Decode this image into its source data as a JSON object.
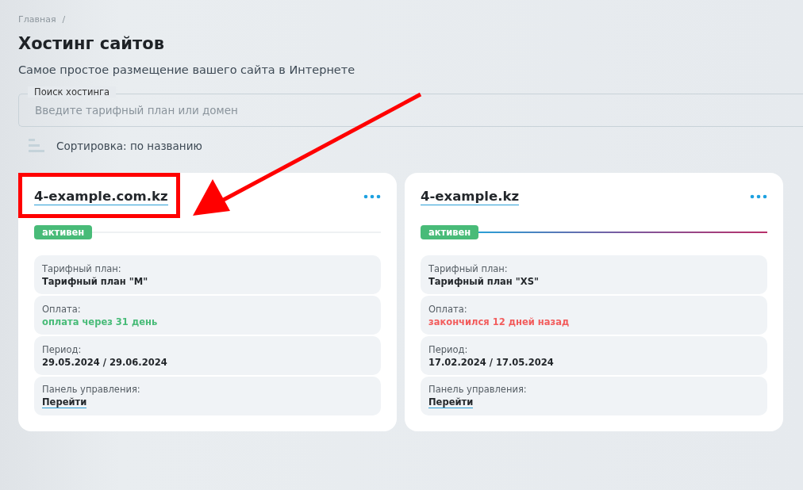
{
  "breadcrumb": [
    "Главная",
    "/"
  ],
  "title": "Хостинг сайтов",
  "subtitle": "Самое простое размещение вашего сайта в Интернете",
  "search": {
    "label": "Поиск хостинга",
    "placeholder": "Введите тарифный план или домен"
  },
  "sort": {
    "label": "Сортировка: по названию"
  },
  "hostings": [
    {
      "domain": "4-example.com.kz",
      "highlighted": true,
      "status": "активен",
      "rows": [
        {
          "label": "Тарифный план:",
          "value": "Тарифный план \"M\"",
          "kind": "plain"
        },
        {
          "label": "Оплата:",
          "value": "оплата через 31 день",
          "kind": "ok"
        },
        {
          "label": "Период:",
          "value": "29.05.2024",
          "separator": "/",
          "value2": "29.06.2024",
          "kind": "period"
        },
        {
          "label": "Панель управления:",
          "value": "Перейти",
          "kind": "link"
        }
      ],
      "expired": false
    },
    {
      "domain": "4-example.kz",
      "highlighted": false,
      "status": "активен",
      "rows": [
        {
          "label": "Тарифный план:",
          "value": "Тарифный план \"XS\"",
          "kind": "plain"
        },
        {
          "label": "Оплата:",
          "value": "закончился 12 дней назад",
          "kind": "overdue"
        },
        {
          "label": "Период:",
          "value": "17.02.2024",
          "separator": "/",
          "value2": "17.05.2024",
          "kind": "period"
        },
        {
          "label": "Панель управления:",
          "value": "Перейти",
          "kind": "link"
        }
      ],
      "expired": true
    }
  ]
}
